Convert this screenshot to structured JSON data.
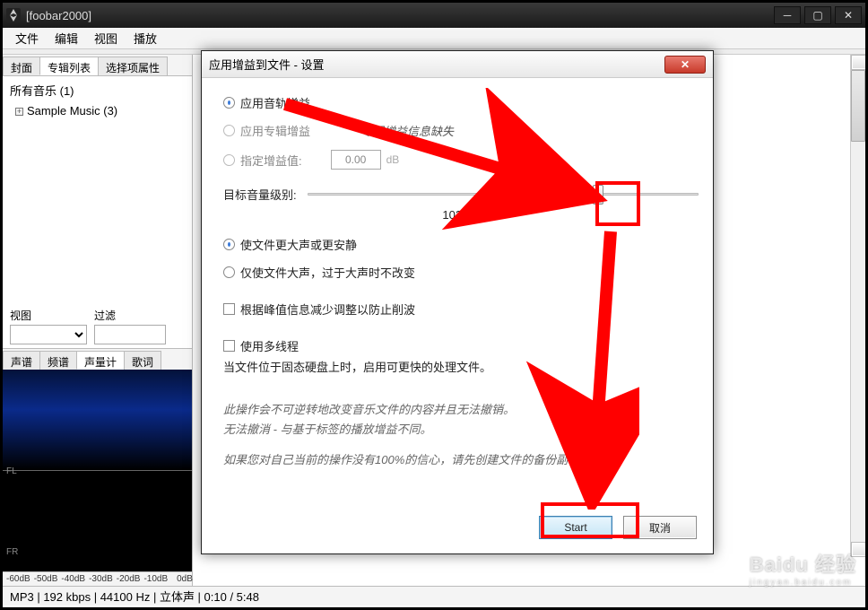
{
  "window": {
    "title": "[foobar2000]"
  },
  "menubar": [
    "文件",
    "编辑",
    "视图",
    "播放"
  ],
  "left_tabs": {
    "cover": "封面",
    "album_list": "专辑列表",
    "select_props": "选择项属性"
  },
  "tree": {
    "root": "所有音乐 (1)",
    "child": "Sample Music (3)"
  },
  "filter": {
    "view_label": "视图",
    "filter_label": "过滤"
  },
  "vis_tabs": {
    "spectrogram": "声谱",
    "spectrum": "频谱",
    "vu": "声量计",
    "lyrics": "歌词"
  },
  "vis": {
    "fl": "FL",
    "fr": "FR"
  },
  "db_scale": [
    "-60dB",
    "-50dB",
    "-40dB",
    "-30dB",
    "-20dB",
    "-10dB",
    "0dB"
  ],
  "status": "MP3 | 192 kbps | 44100 Hz | 立体声 | 0:10 / 5:48",
  "dialog": {
    "title": "应用增益到文件 - 设置",
    "opt_track_gain": "应用音轨增益",
    "opt_album_gain": "应用专辑增益",
    "album_gain_missing": "专辑增益信息缺失",
    "opt_specify_gain": "指定增益值:",
    "specify_value": "0.00",
    "specify_unit": "dB",
    "target_level_label": "目标音量级别:",
    "target_level_value": "102 dB",
    "opt_louder_quieter": "使文件更大声或更安静",
    "opt_only_louder": "仅使文件大声，过于大声时不改变",
    "chk_peak": "根据峰值信息减少调整以防止削波",
    "chk_multithread": "使用多线程",
    "multithread_note": "当文件位于固态硬盘上时，启用可更快的处理文件。",
    "warn1": "此操作会不可逆转地改变音乐文件的内容并且无法撤销。",
    "warn2": "无法撤消 - 与基于标签的播放增益不同。",
    "warn3": "如果您对自己当前的操作没有100%的信心，请先创建文件的备份副本。",
    "btn_start": "Start",
    "btn_cancel": "取消"
  },
  "watermark": {
    "brand": "Baidu 经验",
    "sub": "jingyan.baidu.com"
  }
}
